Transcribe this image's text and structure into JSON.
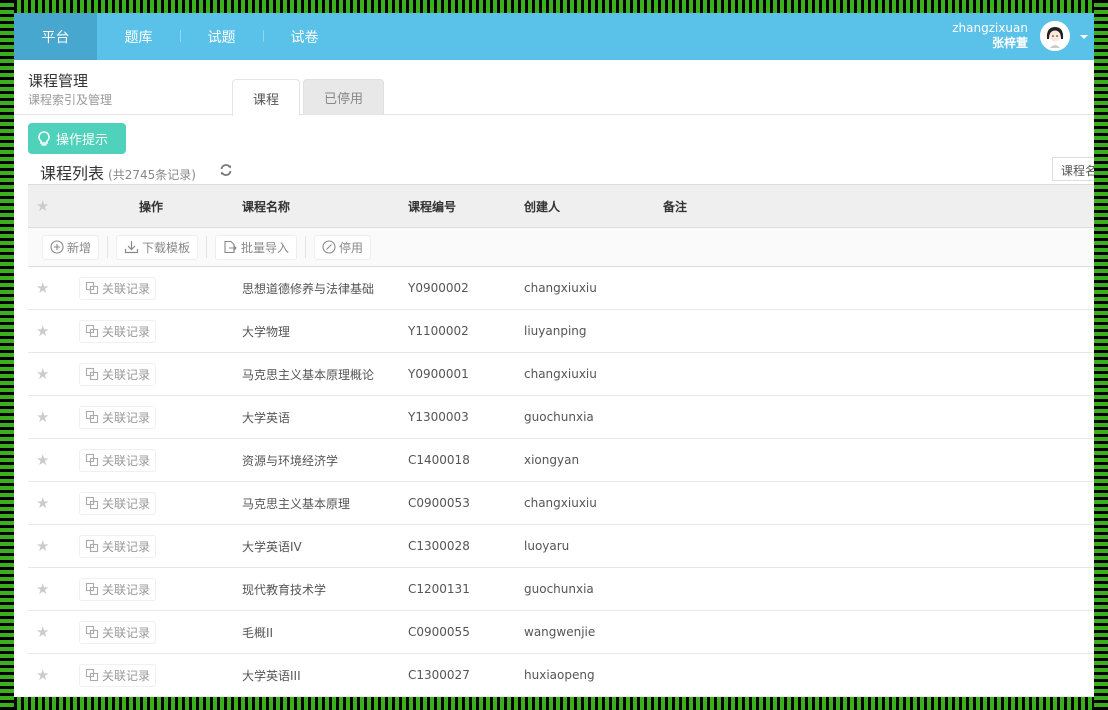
{
  "topnav": {
    "items": [
      {
        "label": "平台",
        "active": true
      },
      {
        "label": "题库",
        "active": false
      },
      {
        "label": "试题",
        "active": false
      },
      {
        "label": "试卷",
        "active": false
      }
    ],
    "user": {
      "username": "zhangzixuan",
      "display_name": "张梓萱"
    }
  },
  "page": {
    "title": "课程管理",
    "subtitle": "课程索引及管理",
    "tabs": [
      {
        "label": "课程",
        "active": true
      },
      {
        "label": "已停用",
        "active": false
      }
    ],
    "hint_button": "操作提示",
    "list_title": "课程列表",
    "list_count": "(共2745条记录)",
    "search_select": "课程名称"
  },
  "table": {
    "headers": {
      "op": "操作",
      "name": "课程名称",
      "code": "课程编号",
      "creator": "创建人",
      "note": "备注"
    },
    "toolbar": {
      "add": "新增",
      "download": "下载模板",
      "import": "批量导入",
      "disable": "停用"
    },
    "row_action": "关联记录",
    "rows": [
      {
        "name": "思想道德修养与法律基础",
        "code": "Y0900002",
        "creator": "changxiuxiu"
      },
      {
        "name": "大学物理",
        "code": "Y1100002",
        "creator": "liuyanping"
      },
      {
        "name": "马克思主义基本原理概论",
        "code": "Y0900001",
        "creator": "changxiuxiu"
      },
      {
        "name": "大学英语",
        "code": "Y1300003",
        "creator": "guochunxia"
      },
      {
        "name": "资源与环境经济学",
        "code": "C1400018",
        "creator": "xiongyan"
      },
      {
        "name": "马克思主义基本原理",
        "code": "C0900053",
        "creator": "changxiuxiu"
      },
      {
        "name": "大学英语IV",
        "code": "C1300028",
        "creator": "luoyaru"
      },
      {
        "name": "现代教育技术学",
        "code": "C1200131",
        "creator": "guochunxia"
      },
      {
        "name": "毛概II",
        "code": "C0900055",
        "creator": "wangwenjie"
      },
      {
        "name": "大学英语III",
        "code": "C1300027",
        "creator": "huxiaopeng"
      }
    ]
  },
  "colors": {
    "nav_bg": "#5ac1e8",
    "nav_active": "#48a7cf",
    "hint_bg": "#4fd1bb"
  }
}
